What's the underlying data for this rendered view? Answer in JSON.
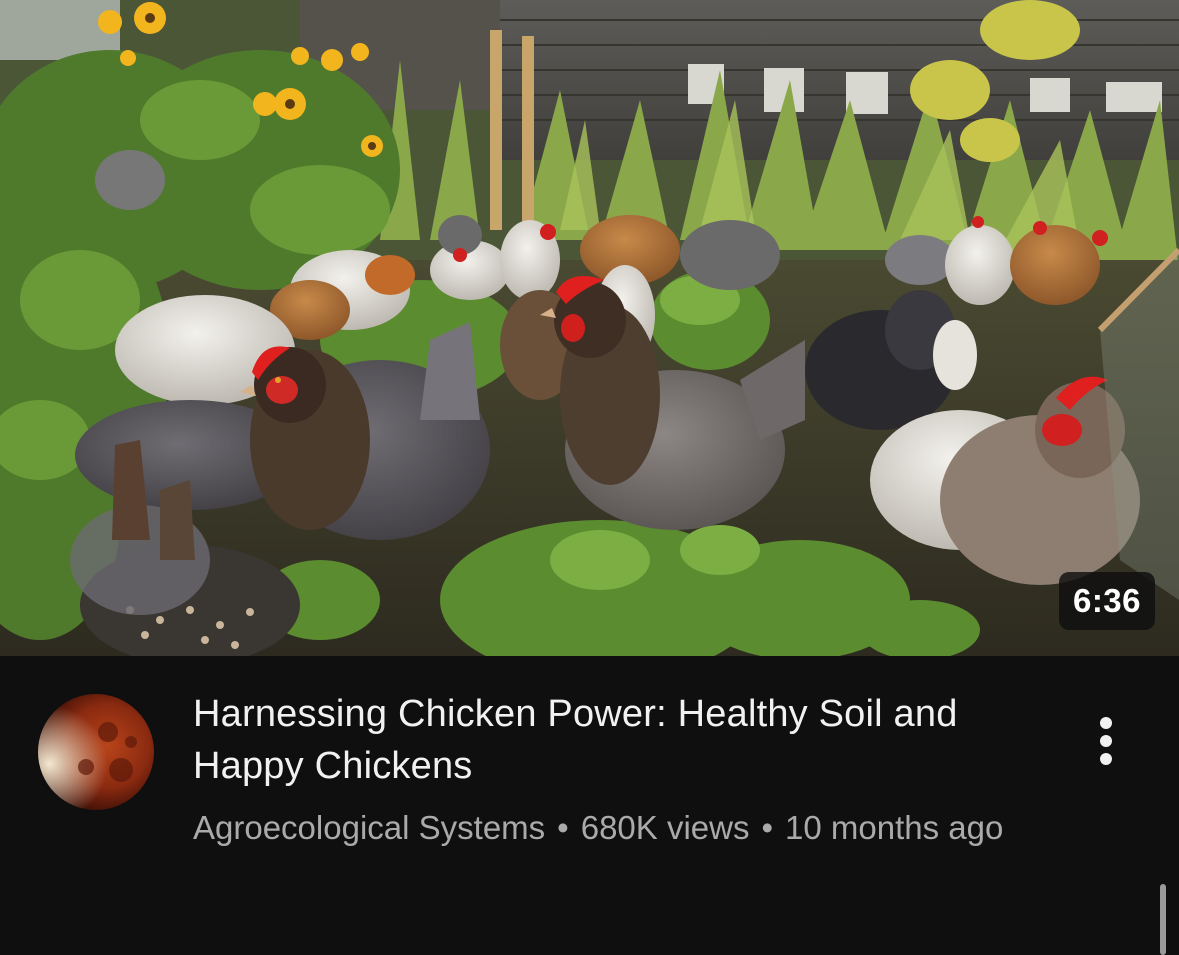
{
  "video": {
    "title": "Harnessing Chicken Power: Healthy Soil and Happy Chickens",
    "channel": "Agroecological Systems",
    "views": "680K views",
    "age": "10 months ago",
    "separator": "•",
    "duration": "6:36"
  },
  "icons": {
    "menu": "more-vert-icon",
    "avatar": "channel-avatar-moon"
  },
  "colors": {
    "background": "#0f0f0f",
    "title_text": "#f1f1f1",
    "secondary_text": "#aaaaaa",
    "duration_badge": "#0f0f0f"
  }
}
